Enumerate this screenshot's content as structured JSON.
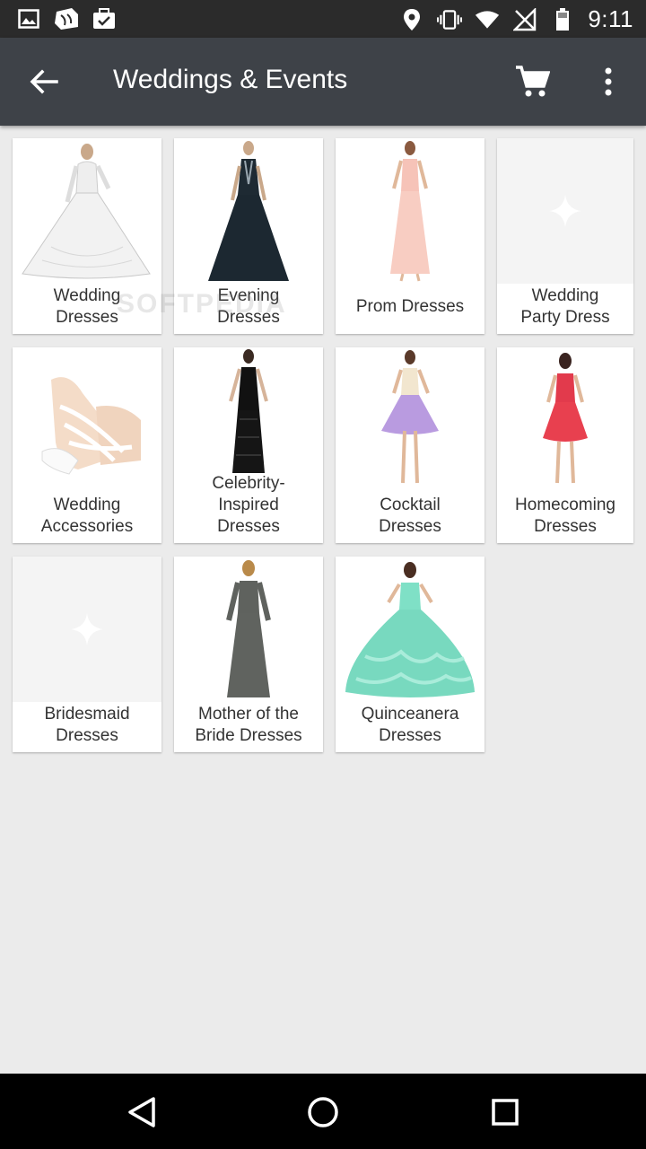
{
  "status_bar": {
    "time": "9:11",
    "left_icons": [
      "image-icon",
      "wallet-icon",
      "briefcase-check-icon"
    ],
    "right_icons": [
      "location-icon",
      "vibrate-icon",
      "wifi-icon",
      "no-signal-icon",
      "battery-icon"
    ]
  },
  "app_bar": {
    "title": "Weddings & Events",
    "back_icon": "arrow-left-icon",
    "cart_icon": "cart-icon",
    "more_icon": "more-vert-icon",
    "background": "#3e4248"
  },
  "categories": [
    {
      "label": "Wedding\nDresses",
      "image": "wedding-dress-image"
    },
    {
      "label": "Evening\nDresses",
      "image": "evening-dress-image"
    },
    {
      "label": "Prom Dresses",
      "image": "prom-dress-image"
    },
    {
      "label": "Wedding\nParty Dress",
      "image": "placeholder"
    },
    {
      "label": "Wedding\nAccessories",
      "image": "lace-gloves-image"
    },
    {
      "label": "Celebrity-\nInspired\nDresses",
      "image": "celebrity-dress-image"
    },
    {
      "label": "Cocktail\nDresses",
      "image": "cocktail-dress-image"
    },
    {
      "label": "Homecoming\nDresses",
      "image": "homecoming-dress-image"
    },
    {
      "label": "Bridesmaid\nDresses",
      "image": "placeholder"
    },
    {
      "label": "Mother of the\nBride Dresses",
      "image": "mother-bride-dress-image"
    },
    {
      "label": "Quinceanera\nDresses",
      "image": "quinceanera-dress-image"
    }
  ],
  "watermark": "SOFTPEDIA",
  "nav_bar": {
    "icons": [
      "back-triangle-icon",
      "home-circle-icon",
      "recents-square-icon"
    ]
  }
}
